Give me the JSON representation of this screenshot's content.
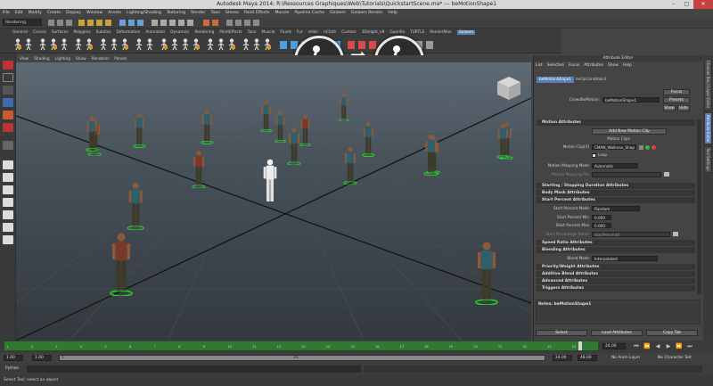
{
  "window": {
    "title": "Autodesk Maya 2014: R:\\Ressources Graphiques\\Web\\Tutorials\\QuickstartScene.ma*   ---   beMotionShape1",
    "minimize": "–",
    "maximize": "□",
    "close": "✕"
  },
  "menubar": [
    "File",
    "Edit",
    "Modify",
    "Create",
    "Display",
    "Window",
    "Assets",
    "Lighting/Shading",
    "Texturing",
    "Render",
    "Toon",
    "Stereo",
    "Paint Effects",
    "Muscle",
    "Pipeline Cache",
    "Golaem",
    "Golaem Render",
    "Help"
  ],
  "statusline": {
    "mode": "Rendering"
  },
  "shelf_tabs": [
    "General",
    "Curves",
    "Surfaces",
    "Polygons",
    "Subdivs",
    "Deformation",
    "Animation",
    "Dynamics",
    "Rendering",
    "PaintEffects",
    "Toon",
    "Muscle",
    "Fluids",
    "Fur",
    "nHair",
    "nCloth",
    "Custom",
    "3Delight_v9",
    "Guerilla",
    "TURTLE",
    "RenderMan",
    "Golaem"
  ],
  "shelf_active": "Golaem",
  "panel_menu": [
    "View",
    "Shading",
    "Lighting",
    "Show",
    "Renderer",
    "Panels"
  ],
  "viewcube": "FRONT",
  "attribute_editor": {
    "title": "Attribute Editor",
    "menu": [
      "List",
      "Selected",
      "Focus",
      "Attributes",
      "Show",
      "Help"
    ],
    "node_tabs": [
      "beMotionShape1",
      "beOpCondition1"
    ],
    "node_label": "CrowdBeMotion:",
    "node_value": "beMotionShape1",
    "focus": "Focus",
    "presets": "Presets",
    "show": "Show",
    "hide": "Hide",
    "sections": {
      "motion": "Motion Attributes",
      "starting": "Starting / Stopping Duration Attributes",
      "bodymask": "Body Mask Attributes",
      "startpercent": "Start Percent Attributes",
      "speed": "Speed Ratio Attributes",
      "blending": "Blending Attributes",
      "priority": "Priority/Weight Attributes",
      "additive": "Additive Blend Attributes",
      "advanced": "Advanced Attributes",
      "triggers": "Triggers Attributes"
    },
    "add_clip": "Add New Motion Clip",
    "motion_clips_label": "Motion Clips",
    "motion_clip0_label": "Motion Clip[0]",
    "motion_clip0_value": "CMAN_Walknav_Shap",
    "loop": "Loop",
    "mapping_mode_label": "Motion Mapping Mode",
    "mapping_mode_value": "Automatic",
    "mapping_file_label": "Motion Mapping File",
    "sp_mode_label": "Start Percent Mode",
    "sp_mode_value": "Random",
    "sp_min_label": "Start Percent Min",
    "sp_min_value": "0.000",
    "sp_max_label": "Start Percent Max",
    "sp_max_value": "0.000",
    "sp_var_label": "Start Percentage Name",
    "sp_var_value": "startPercent0",
    "blend_mode_label": "Blend Mode",
    "blend_mode_value": "Interpolated",
    "notes": "Notes: beMotionShape1",
    "select": "Select",
    "load": "Load Attributes",
    "copy": "Copy Tab"
  },
  "side_tabs": [
    "Channel Box / Layer Editor",
    "Attribute Editor",
    "Tool Settings"
  ],
  "timeline": {
    "ticks": [
      "1",
      "2",
      "3",
      "4",
      "5",
      "6",
      "7",
      "8",
      "9",
      "10",
      "11",
      "12",
      "13",
      "14",
      "15",
      "16",
      "17",
      "18",
      "19",
      "20",
      "21",
      "22",
      "23",
      "24"
    ],
    "current": "24.00",
    "current_frame": "24"
  },
  "range": {
    "start": "1.00",
    "inner_start": "1.00",
    "inner_end": "24",
    "end": "24.00",
    "max": "48.00",
    "anim_layer": "No Anim Layer",
    "char_set": "No Character Set",
    "start_box": "1"
  },
  "cmdline": {
    "label": "Python"
  },
  "helpline": "Select Tool: select an object",
  "callout": {
    "arrow": "➡"
  },
  "colors": {
    "accent": "#5b7fb0",
    "timeline": "#2f7a2f",
    "selection_ring": "#22d422"
  }
}
